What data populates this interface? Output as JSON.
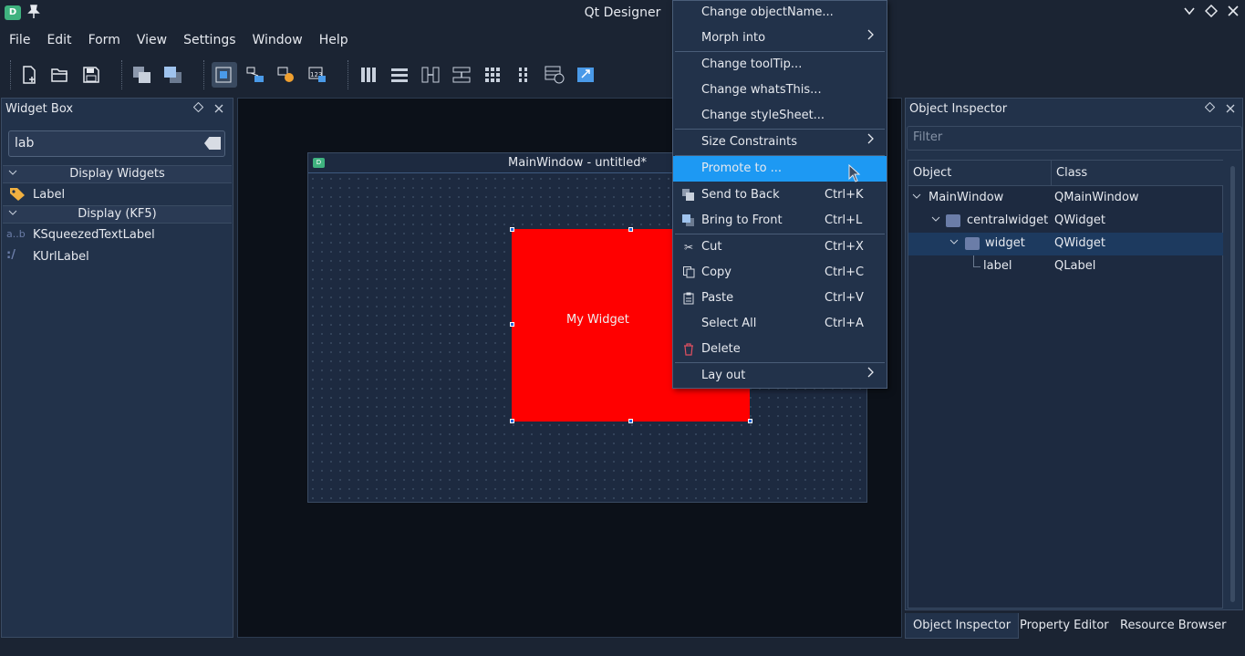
{
  "titlebar": {
    "title": "Qt Designer",
    "app_icon": "D",
    "buttons": [
      "chevron-down-icon",
      "diamond-icon",
      "close-icon"
    ]
  },
  "menubar": [
    "File",
    "Edit",
    "Form",
    "View",
    "Settings",
    "Window",
    "Help"
  ],
  "widget_box": {
    "title": "Widget Box",
    "search_value": "lab",
    "categories": [
      {
        "name": "Display Widgets",
        "items": [
          "Label"
        ]
      },
      {
        "name": "Display (KF5)",
        "items": [
          "KSqueezedTextLabel",
          "KUrlLabel"
        ]
      }
    ]
  },
  "form": {
    "title": "MainWindow - untitled*",
    "widget_text": "My Widget",
    "widget_color": "#ff0000"
  },
  "context_menu": {
    "items": [
      {
        "label": "Change objectName...",
        "shortcut": "",
        "submenu": false
      },
      {
        "label": "Morph into",
        "shortcut": "",
        "submenu": true
      },
      {
        "label": "Change toolTip...",
        "shortcut": "",
        "submenu": false
      },
      {
        "label": "Change whatsThis...",
        "shortcut": "",
        "submenu": false
      },
      {
        "label": "Change styleSheet...",
        "shortcut": "",
        "submenu": false
      },
      {
        "label": "Size Constraints",
        "shortcut": "",
        "submenu": true
      },
      {
        "label": "Promote to ...",
        "shortcut": "",
        "submenu": false,
        "highlighted": true
      },
      {
        "label": "Send to Back",
        "shortcut": "Ctrl+K",
        "submenu": false
      },
      {
        "label": "Bring to Front",
        "shortcut": "Ctrl+L",
        "submenu": false
      },
      {
        "label": "Cut",
        "shortcut": "Ctrl+X",
        "submenu": false
      },
      {
        "label": "Copy",
        "shortcut": "Ctrl+C",
        "submenu": false
      },
      {
        "label": "Paste",
        "shortcut": "Ctrl+V",
        "submenu": false
      },
      {
        "label": "Select All",
        "shortcut": "Ctrl+A",
        "submenu": false
      },
      {
        "label": "Delete",
        "shortcut": "",
        "submenu": false
      },
      {
        "label": "Lay out",
        "shortcut": "",
        "submenu": true
      }
    ]
  },
  "object_inspector": {
    "title": "Object Inspector",
    "filter_placeholder": "Filter",
    "columns": [
      "Object",
      "Class"
    ],
    "rows": [
      {
        "object": "MainWindow",
        "class": "QMainWindow"
      },
      {
        "object": "centralwidget",
        "class": "QWidget"
      },
      {
        "object": "widget",
        "class": "QWidget",
        "selected": true
      },
      {
        "object": "label",
        "class": "QLabel"
      }
    ]
  },
  "bottom_tabs": [
    "Object Inspector",
    "Property Editor",
    "Resource Browser"
  ],
  "colors": {
    "accent": "#1d99f3",
    "background": "#1b2433",
    "panel": "#22324a"
  }
}
